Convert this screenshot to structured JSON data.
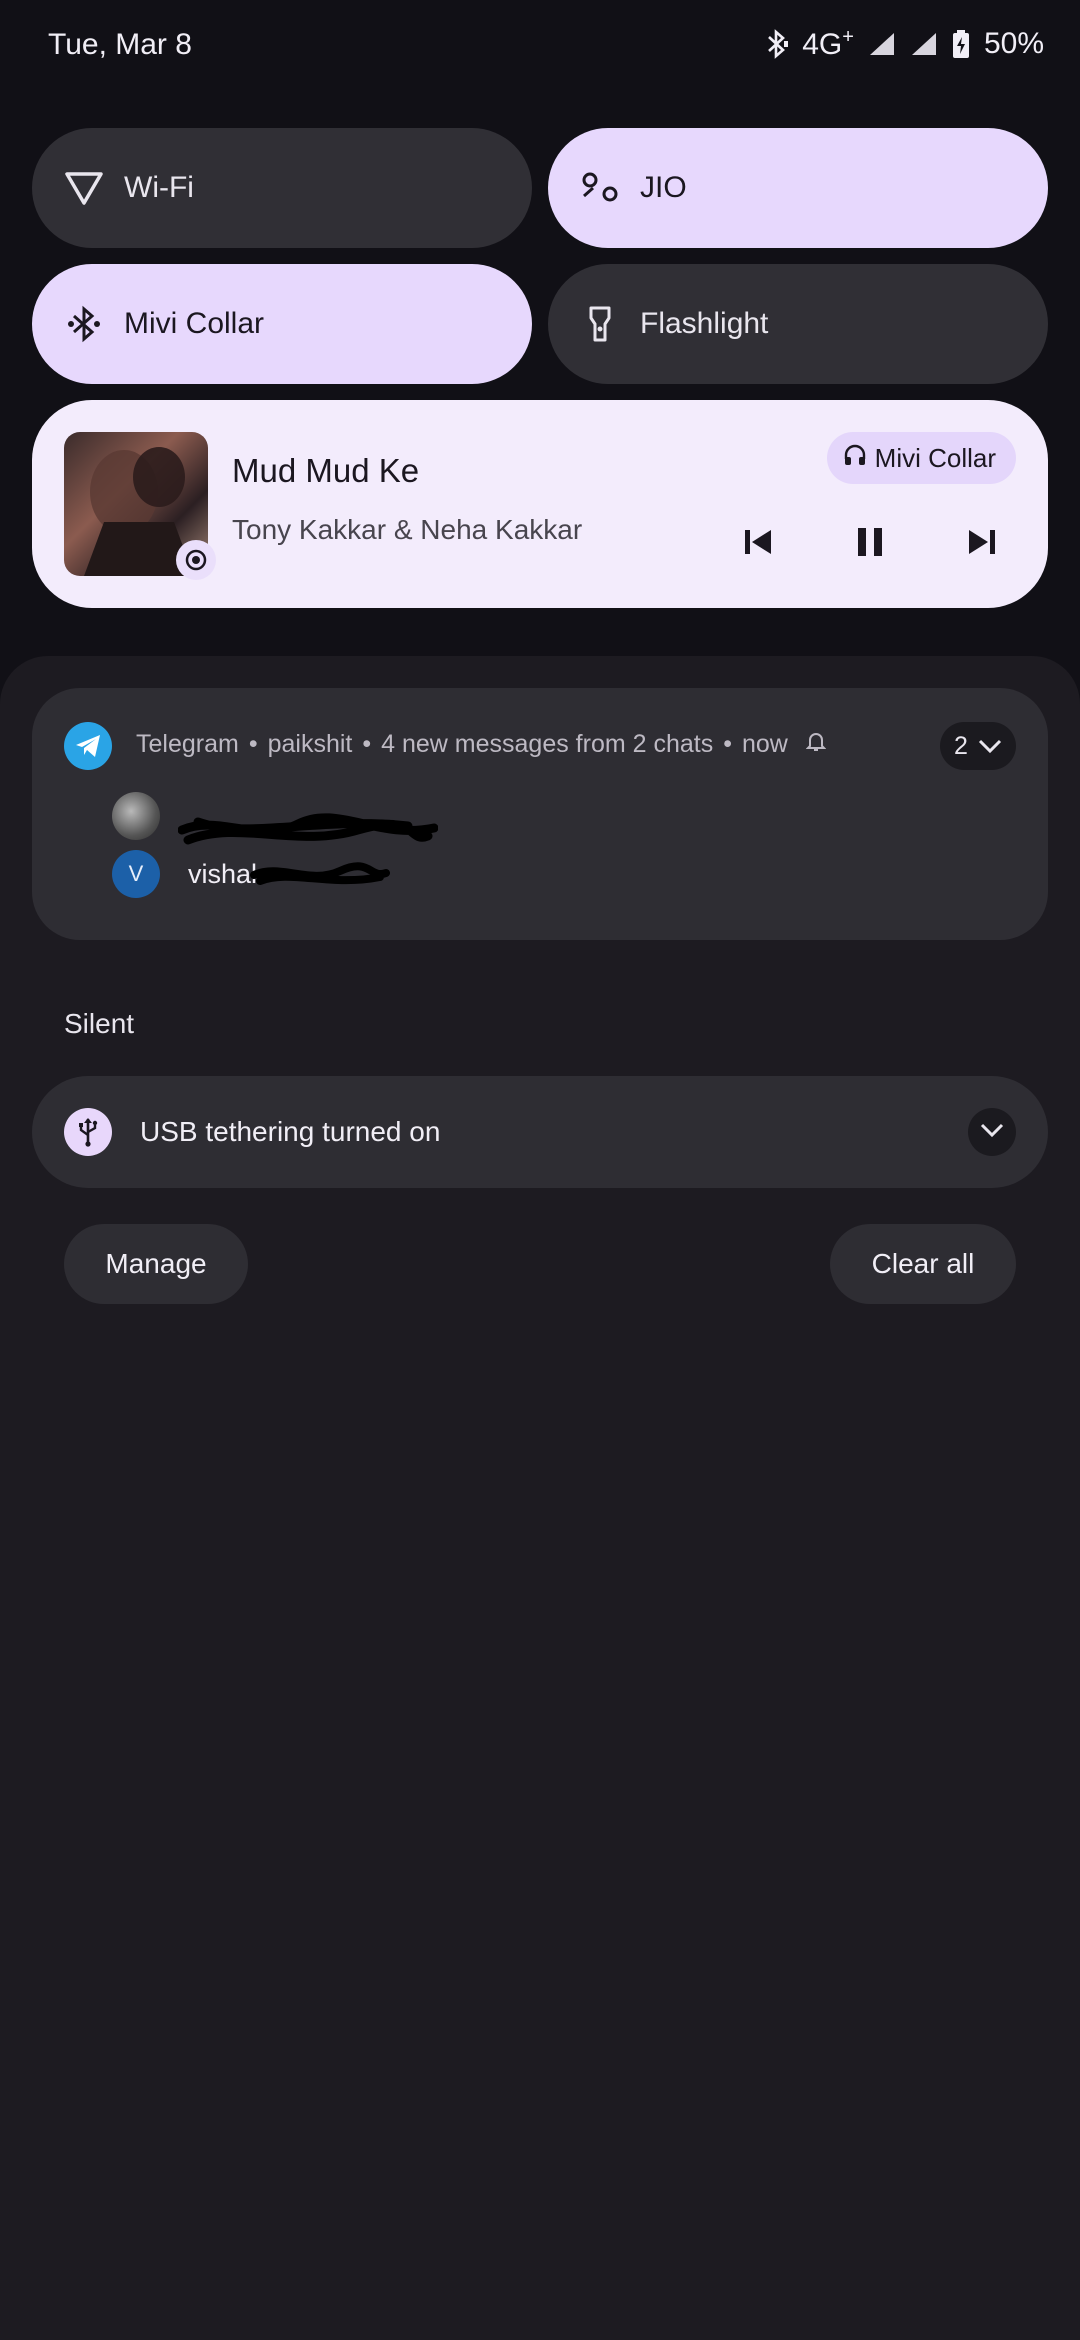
{
  "status": {
    "date": "Tue, Mar 8",
    "network": "4G",
    "network_plus": "+",
    "battery": "50%"
  },
  "tiles": [
    {
      "label": "Wi-Fi",
      "icon": "wifi-icon",
      "active": false
    },
    {
      "label": "JIO",
      "icon": "mobile-data-icon",
      "active": true
    },
    {
      "label": "Mivi Collar",
      "icon": "bluetooth-icon",
      "active": true
    },
    {
      "label": "Flashlight",
      "icon": "flashlight-icon",
      "active": false
    }
  ],
  "media": {
    "title": "Mud Mud Ke",
    "artist": "Tony Kakkar & Neha Kakkar",
    "output": "Mivi Collar",
    "state": "playing"
  },
  "telegram": {
    "app": "Telegram",
    "account": "paikshit",
    "summary": "4 new messages from 2 chats",
    "time": "now",
    "count": "2",
    "messages": [
      {
        "sender": ""
      },
      {
        "sender": "vishal",
        "initial": "V"
      }
    ]
  },
  "silent_label": "Silent",
  "usb": {
    "title": "USB tethering turned on"
  },
  "actions": {
    "manage": "Manage",
    "clear_all": "Clear all"
  },
  "colors": {
    "background": "#111016",
    "shade": "#1d1b21",
    "tile_active": "#e7d8fd",
    "tile_inactive": "#302f35",
    "telegram_blue": "#2aa4e6"
  }
}
